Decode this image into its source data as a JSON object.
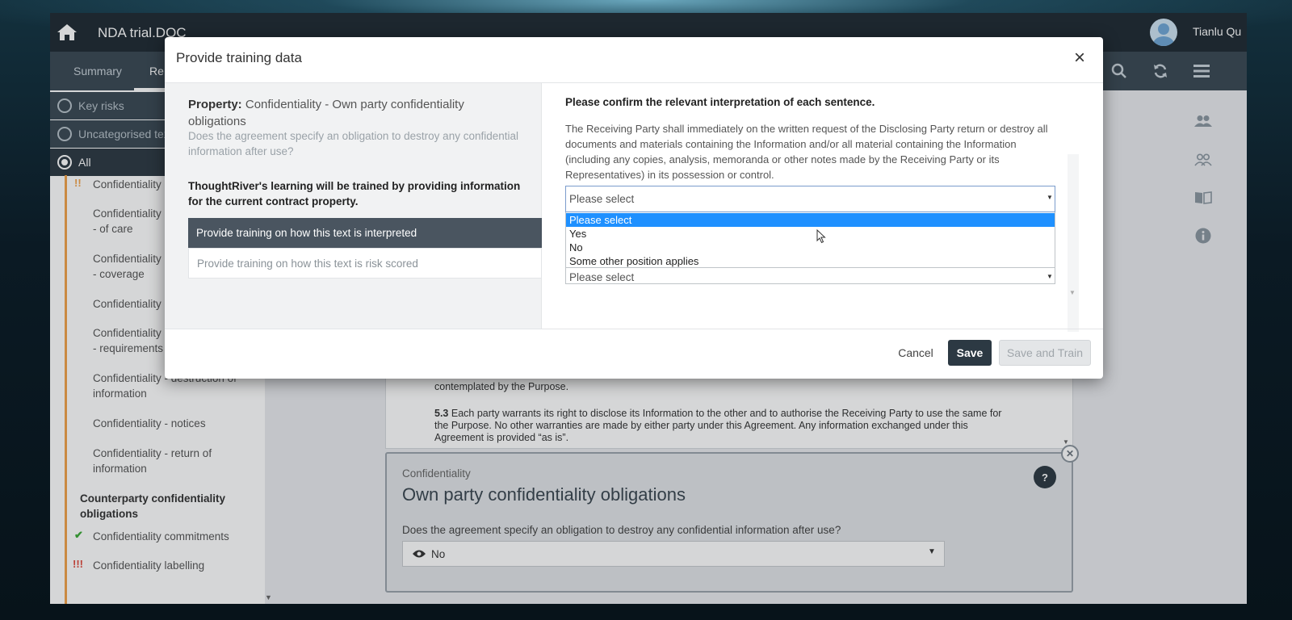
{
  "header": {
    "doc_title": "NDA trial.DOC",
    "user_name": "Tianlu Qu"
  },
  "nav": {
    "tabs": [
      "Summary",
      "Re"
    ],
    "active_tab": 1
  },
  "sidebar": {
    "filters": [
      "Key risks",
      "Uncategorised tex",
      "All"
    ],
    "items": [
      {
        "label": "Confidentiality I",
        "mark": "!!"
      },
      {
        "label": "Confidentiality - of care",
        "mark": ""
      },
      {
        "label": "Confidentiality - coverage",
        "mark": ""
      },
      {
        "label": "Confidentiality -",
        "mark": ""
      },
      {
        "label": "Confidentiality - requirements",
        "mark": ""
      },
      {
        "label": "Confidentiality - destruction of information",
        "mark": ""
      },
      {
        "label": "Confidentiality - notices",
        "mark": ""
      },
      {
        "label": "Confidentiality - return of information",
        "mark": ""
      }
    ],
    "group": "Counterparty confidentiality obligations",
    "group_items": [
      {
        "label": "Confidentiality commitments",
        "mark": "✔"
      },
      {
        "label": "Confidentiality labelling",
        "mark": "!!!"
      }
    ]
  },
  "document": {
    "p1": "contemplated by the Purpose.",
    "p2_num": "5.3",
    "p2": "Each party warrants its right to disclose its Information to the other and to authorise the Receiving Party to use the same for the Purpose. No other warranties are made by either party under this Agreement. Any information exchanged under this Agreement is provided “as is”."
  },
  "card": {
    "category": "Confidentiality",
    "title": "Own party confidentiality obligations",
    "question": "Does the agreement specify an obligation to destroy any confidential information after use?",
    "answer": "No",
    "help": "?"
  },
  "modal": {
    "title": "Provide training data",
    "property_label": "Property:",
    "property_value": "Confidentiality - Own party confidentiality obligations",
    "property_question": "Does the agreement specify an obligation to destroy any confidential information after use?",
    "training_note": "ThoughtRiver's learning will be trained by providing information for the current contract property.",
    "options": [
      "Provide training on how this text is interpreted",
      "Provide training on how this text is risk scored"
    ],
    "instruction": "Please confirm the relevant interpretation of each sentence.",
    "sentence": "The Receiving Party shall immediately on the written request of the Disclosing Party return or destroy all documents and materials containing the Information and/or all material containing the Information (including any copies, analysis, memoranda or other notes made by the Receiving Party or its Representatives) in its possession or control.",
    "select_value": "Please select",
    "dropdown_options": [
      "Please select",
      "Yes",
      "No",
      "Some other position applies"
    ],
    "second_select": "Please select",
    "cancel": "Cancel",
    "save": "Save",
    "save_train": "Save and Train"
  }
}
